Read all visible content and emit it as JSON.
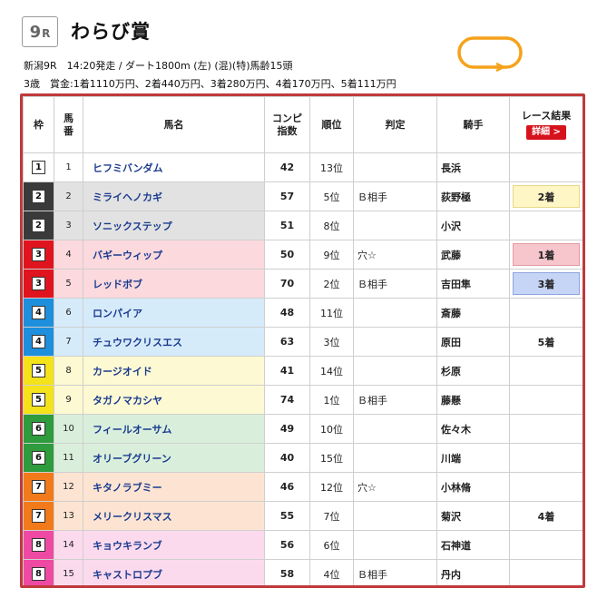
{
  "race": {
    "number": "9",
    "number_suffix": "R",
    "name": "わらび賞",
    "info_line1": "新潟9R　14:20発走 / ダート1800m (左) (混)(特)馬齢15頭",
    "info_line2": " 3歳　賞金:1着1110万円、2着440万円、3着280万円、4着170万円、5着111万円"
  },
  "icons": {
    "course": "track-course-icon",
    "detail": "chevron-right-icon"
  },
  "colors": {
    "accent": "#c0393b",
    "detail_button": "#d6131d",
    "horse_name": "#1a3b8f"
  },
  "table": {
    "headers": {
      "waku": "枠",
      "umaban": "馬\n番",
      "name": "馬名",
      "index": "コンピ\n指数",
      "rank": "順位",
      "judge": "判定",
      "jockey": "騎手",
      "result": "レース結果",
      "detail_button": "詳細 >"
    },
    "rows": [
      {
        "waku": "1",
        "umaban": "1",
        "name": "ヒフミバンダム",
        "index": "42",
        "rank": "13位",
        "judge": "",
        "jockey": "長浜",
        "result": ""
      },
      {
        "waku": "2",
        "umaban": "2",
        "name": "ミライヘノカギ",
        "index": "57",
        "rank": "5位",
        "judge": "Ｂ相手",
        "jockey": "荻野極",
        "result": "2着"
      },
      {
        "waku": "2",
        "umaban": "3",
        "name": "ソニックステップ",
        "index": "51",
        "rank": "8位",
        "judge": "",
        "jockey": "小沢",
        "result": ""
      },
      {
        "waku": "3",
        "umaban": "4",
        "name": "バギーウィップ",
        "index": "50",
        "rank": "9位",
        "judge": "穴☆",
        "jockey": "武藤",
        "result": "1着"
      },
      {
        "waku": "3",
        "umaban": "5",
        "name": "レッドボブ",
        "index": "70",
        "rank": "2位",
        "judge": "Ｂ相手",
        "jockey": "吉田隼",
        "result": "3着"
      },
      {
        "waku": "4",
        "umaban": "6",
        "name": "ロンパイア",
        "index": "48",
        "rank": "11位",
        "judge": "",
        "jockey": "斎藤",
        "result": ""
      },
      {
        "waku": "4",
        "umaban": "7",
        "name": "チュウワクリスエス",
        "index": "63",
        "rank": "3位",
        "judge": "",
        "jockey": "原田",
        "result": "5着"
      },
      {
        "waku": "5",
        "umaban": "8",
        "name": "カージオイド",
        "index": "41",
        "rank": "14位",
        "judge": "",
        "jockey": "杉原",
        "result": ""
      },
      {
        "waku": "5",
        "umaban": "9",
        "name": "タガノマカシヤ",
        "index": "74",
        "rank": "1位",
        "judge": "Ｂ相手",
        "jockey": "藤懸",
        "result": ""
      },
      {
        "waku": "6",
        "umaban": "10",
        "name": "フィールオーサム",
        "index": "49",
        "rank": "10位",
        "judge": "",
        "jockey": "佐々木",
        "result": ""
      },
      {
        "waku": "6",
        "umaban": "11",
        "name": "オリーブグリーン",
        "index": "40",
        "rank": "15位",
        "judge": "",
        "jockey": "川端",
        "result": ""
      },
      {
        "waku": "7",
        "umaban": "12",
        "name": "キタノラブミー",
        "index": "46",
        "rank": "12位",
        "judge": "穴☆",
        "jockey": "小林脩",
        "result": ""
      },
      {
        "waku": "7",
        "umaban": "13",
        "name": "メリークリスマス",
        "index": "55",
        "rank": "7位",
        "judge": "",
        "jockey": "菊沢",
        "result": "4着"
      },
      {
        "waku": "8",
        "umaban": "14",
        "name": "キョウキランブ",
        "index": "56",
        "rank": "6位",
        "judge": "",
        "jockey": "石神道",
        "result": ""
      },
      {
        "waku": "8",
        "umaban": "15",
        "name": "キャストロプブ",
        "index": "58",
        "rank": "4位",
        "judge": "Ｂ相手",
        "jockey": "丹内",
        "result": ""
      }
    ]
  },
  "waku_colors": {
    "1": {
      "stripe": "#ffffff",
      "row": "#ffffff"
    },
    "2": {
      "stripe": "#3a3a3a",
      "row": "#e2e2e2"
    },
    "3": {
      "stripe": "#e0141e",
      "row": "#fbd9dd"
    },
    "4": {
      "stripe": "#1e8fdc",
      "row": "#d6ebfa"
    },
    "5": {
      "stripe": "#f4e21a",
      "row": "#fdf9d2"
    },
    "6": {
      "stripe": "#2e9b3c",
      "row": "#d9efdb"
    },
    "7": {
      "stripe": "#f27a1a",
      "row": "#fde4d2"
    },
    "8": {
      "stripe": "#ef4aa3",
      "row": "#fcdaed"
    }
  },
  "result_styles": {
    "1着": "res-1",
    "2着": "res-2",
    "3着": "res-3"
  }
}
